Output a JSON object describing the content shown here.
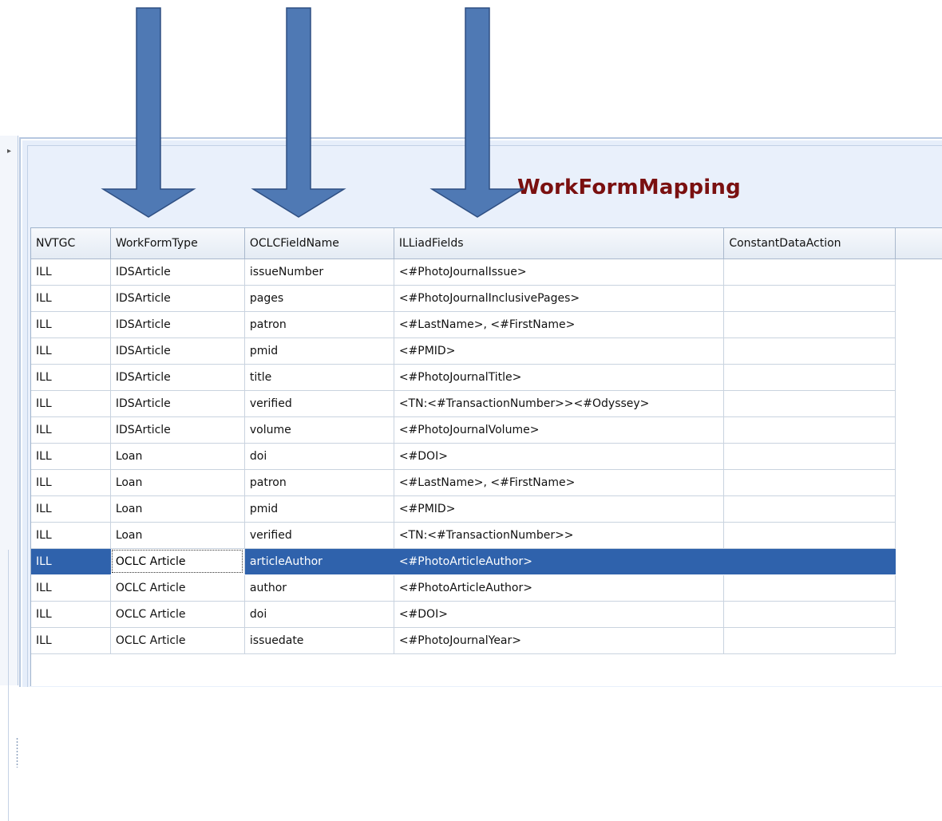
{
  "panel": {
    "title": "WorkFormMapping"
  },
  "grid": {
    "columns": [
      "NVTGC",
      "WorkFormType",
      "OCLCFieldName",
      "ILLiadFields",
      "ConstantDataAction"
    ],
    "rows": [
      [
        "ILL",
        "IDSArticle",
        "issueNumber",
        "<#PhotoJournalIssue>",
        ""
      ],
      [
        "ILL",
        "IDSArticle",
        "pages",
        "<#PhotoJournalInclusivePages>",
        ""
      ],
      [
        "ILL",
        "IDSArticle",
        "patron",
        "<#LastName>, <#FirstName>",
        ""
      ],
      [
        "ILL",
        "IDSArticle",
        "pmid",
        "<#PMID>",
        ""
      ],
      [
        "ILL",
        "IDSArticle",
        "title",
        "<#PhotoJournalTitle>",
        ""
      ],
      [
        "ILL",
        "IDSArticle",
        "verified",
        "<TN:<#TransactionNumber>><#Odyssey>",
        ""
      ],
      [
        "ILL",
        "IDSArticle",
        "volume",
        "<#PhotoJournalVolume>",
        ""
      ],
      [
        "ILL",
        "Loan",
        "doi",
        "<#DOI>",
        ""
      ],
      [
        "ILL",
        "Loan",
        "patron",
        "<#LastName>, <#FirstName>",
        ""
      ],
      [
        "ILL",
        "Loan",
        "pmid",
        "<#PMID>",
        ""
      ],
      [
        "ILL",
        "Loan",
        "verified",
        "<TN:<#TransactionNumber>>",
        ""
      ],
      [
        "ILL",
        "OCLC Article",
        "articleAuthor",
        "<#PhotoArticleAuthor>",
        ""
      ],
      [
        "ILL",
        "OCLC Article",
        "author",
        "<#PhotoArticleAuthor>",
        ""
      ],
      [
        "ILL",
        "OCLC Article",
        "doi",
        "<#DOI>",
        ""
      ],
      [
        "ILL",
        "OCLC Article",
        "issuedate",
        "<#PhotoJournalYear>",
        ""
      ]
    ],
    "selected_row": 11,
    "focused_cell": 1
  },
  "colors": {
    "title": "#7a1010",
    "selection": "#2f62ac",
    "arrow_fill": "#4f79b4",
    "arrow_stroke": "#2f4f82"
  },
  "annotations": {
    "arrows": [
      "arrow-icon",
      "arrow-icon",
      "arrow-icon"
    ]
  }
}
